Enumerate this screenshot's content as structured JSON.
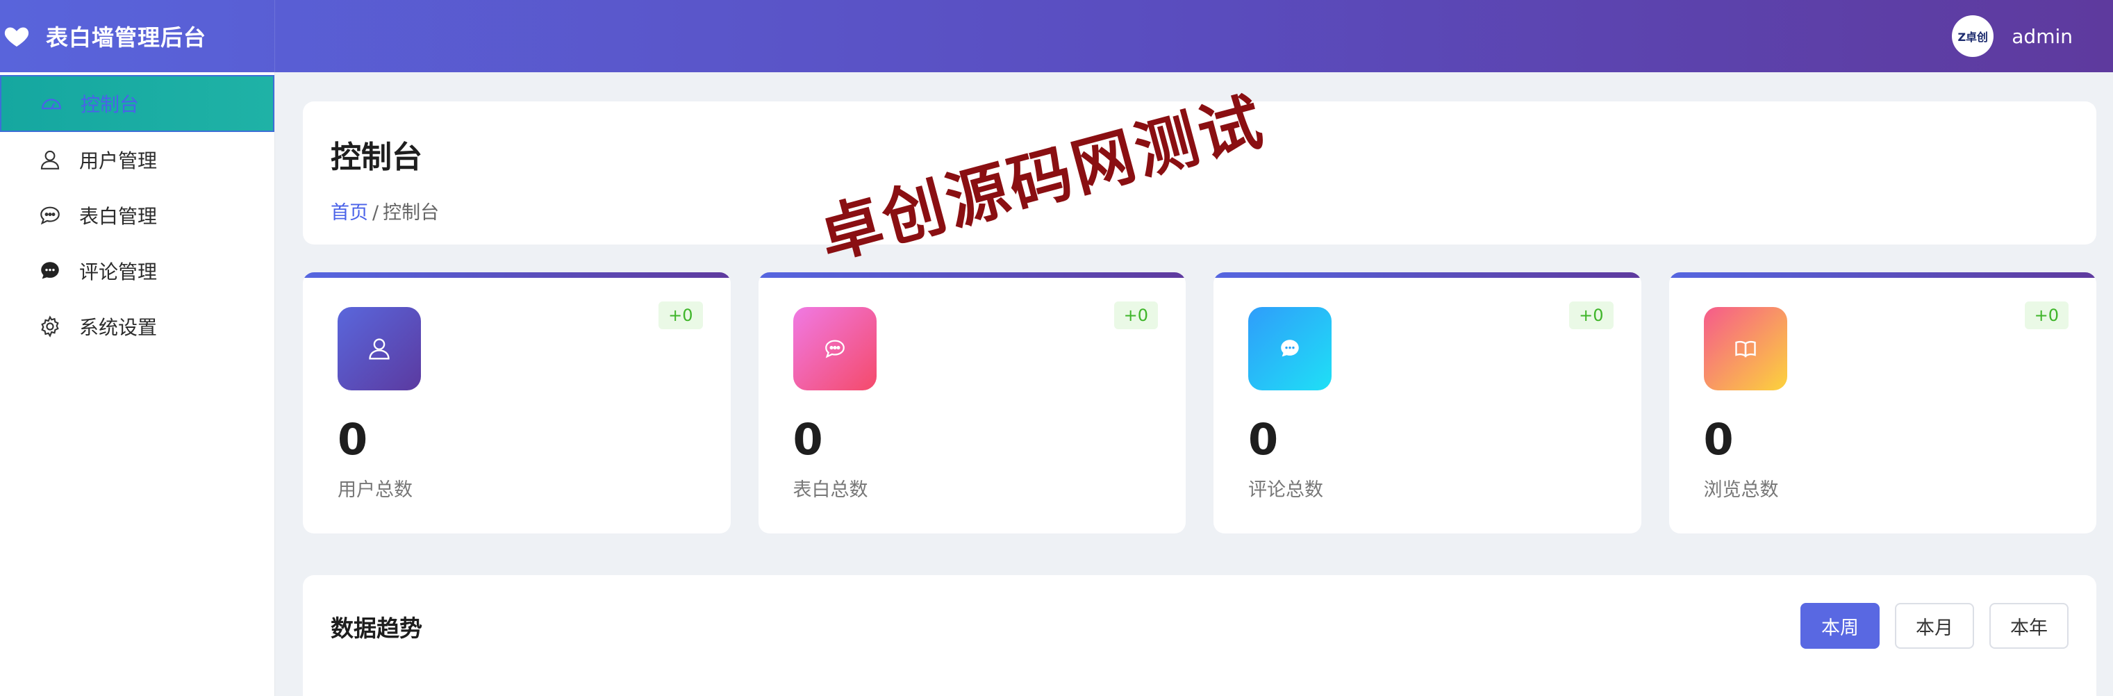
{
  "app": {
    "title": "表白墙管理后台",
    "brand_icon": "heart-icon"
  },
  "user": {
    "name": "admin",
    "avatar_text": "Z卓创"
  },
  "sidebar": {
    "items": [
      {
        "label": "控制台",
        "icon": "dashboard-icon",
        "active": true
      },
      {
        "label": "用户管理",
        "icon": "user-icon",
        "active": false
      },
      {
        "label": "表白管理",
        "icon": "chat-bubble-icon",
        "active": false
      },
      {
        "label": "评论管理",
        "icon": "comment-icon",
        "active": false
      },
      {
        "label": "系统设置",
        "icon": "gear-icon",
        "active": false
      }
    ]
  },
  "page": {
    "title": "控制台",
    "breadcrumb": {
      "home": "首页",
      "separator": "/",
      "current": "控制台"
    }
  },
  "watermark": "卓创源码网测试",
  "stats": [
    {
      "value": "0",
      "label": "用户总数",
      "badge": "+0",
      "icon": "user-icon"
    },
    {
      "value": "0",
      "label": "表白总数",
      "badge": "+0",
      "icon": "chat-bubble-icon"
    },
    {
      "value": "0",
      "label": "评论总数",
      "badge": "+0",
      "icon": "comment-icon"
    },
    {
      "value": "0",
      "label": "浏览总数",
      "badge": "+0",
      "icon": "book-icon"
    }
  ],
  "trend": {
    "title": "数据趋势",
    "tabs": [
      {
        "label": "本周",
        "active": true
      },
      {
        "label": "本月",
        "active": false
      },
      {
        "label": "本年",
        "active": false
      }
    ]
  },
  "colors": {
    "header_start": "#5964db",
    "header_end": "#5e3a9e",
    "active_nav_bg": "#15a7a0",
    "accent": "#4a62e8",
    "badge_green": "#3fb52a",
    "watermark": "#8a0f12"
  }
}
